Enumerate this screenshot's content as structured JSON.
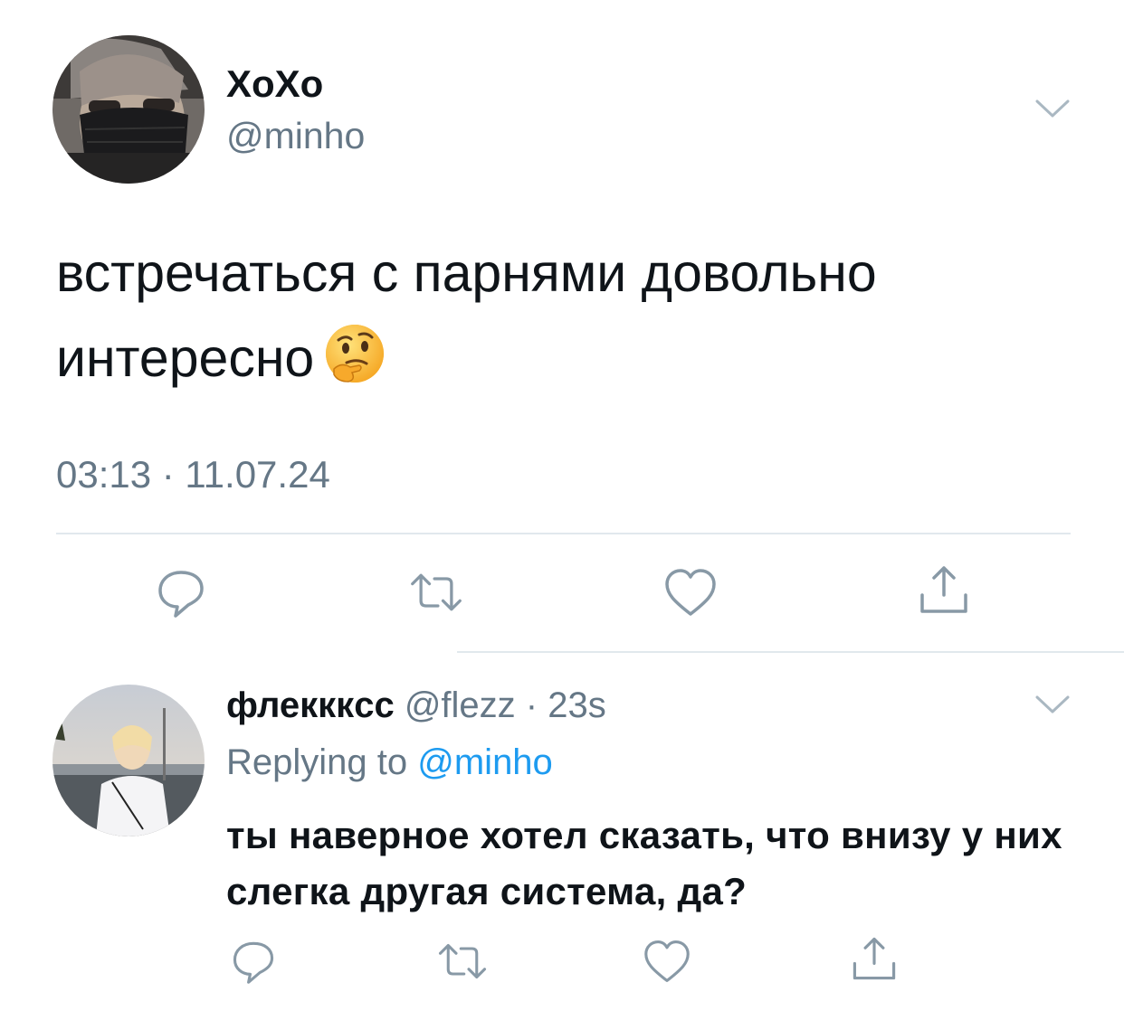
{
  "main_tweet": {
    "display_name": "XoXo",
    "handle": "@minho",
    "text": "встречаться с парнями довольно интересно",
    "emoji": "thinking-face-emoji",
    "timestamp": "03:13 · 11.07.24",
    "actions": [
      "reply-icon",
      "retweet-icon",
      "like-icon",
      "share-icon"
    ]
  },
  "reply": {
    "display_name": "флекккcc",
    "meta": "@flezz · 23s",
    "replying_prefix": "Replying to",
    "replying_to": "@minho",
    "text": "ты наверное хотел сказать, что внизу у них слегка другая система, да?",
    "actions": [
      "reply-icon",
      "retweet-icon",
      "like-icon",
      "share-icon"
    ]
  },
  "colors": {
    "text": "#0f1419",
    "secondary": "#657786",
    "accent": "#1d9bf0",
    "divider": "#e1e8ed"
  }
}
